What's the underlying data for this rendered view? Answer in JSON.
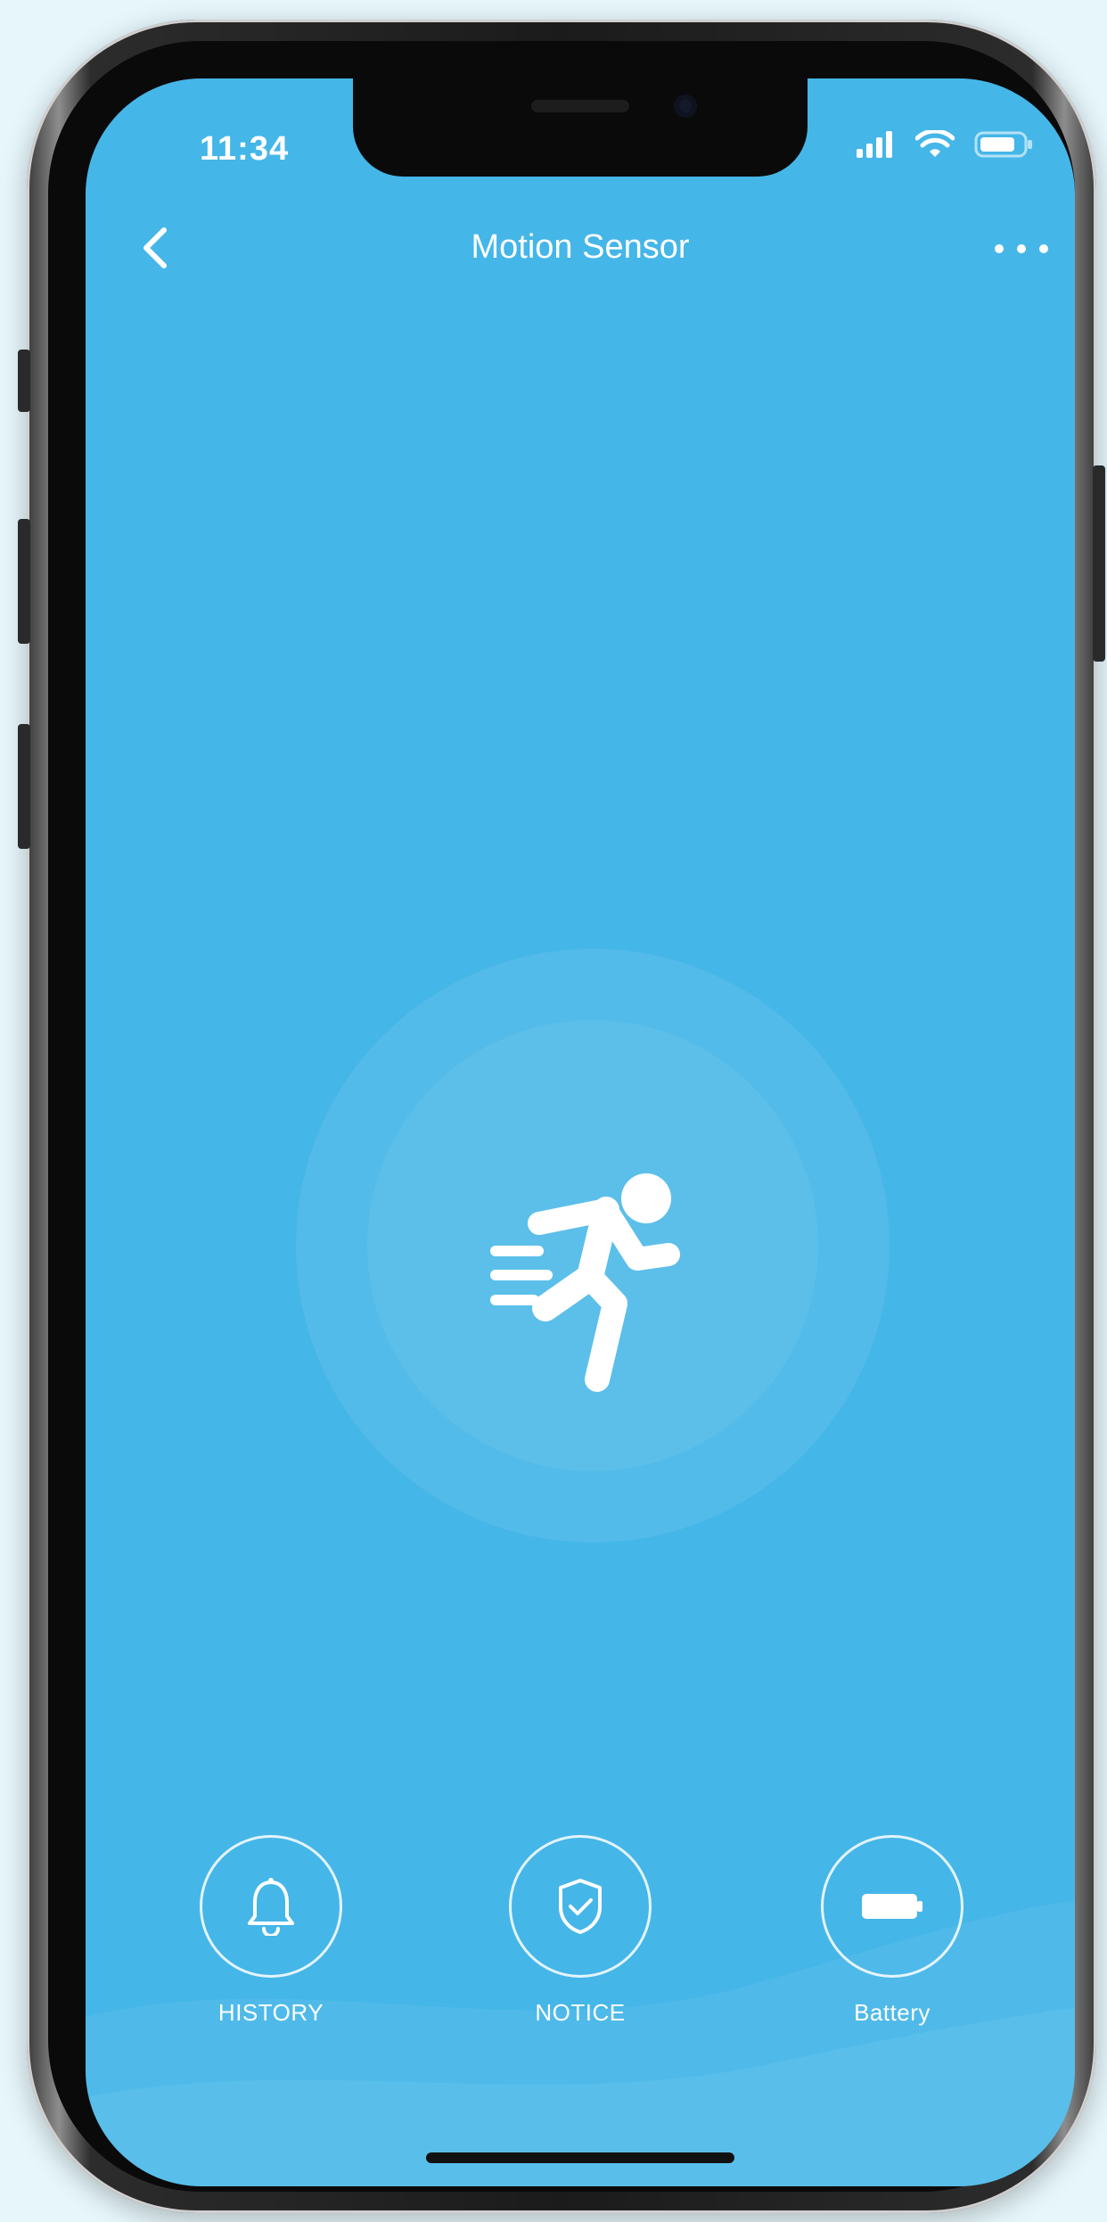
{
  "status_bar": {
    "time": "11:34",
    "icons": [
      "signal-icon",
      "wifi-icon",
      "battery-icon"
    ]
  },
  "nav": {
    "back_icon": "chevron-left-icon",
    "title": "Motion Sensor",
    "more_icon": "more-dots-icon"
  },
  "center": {
    "icon": "running-person-icon"
  },
  "actions": [
    {
      "label": "HISTORY",
      "icon": "bell-icon"
    },
    {
      "label": "NOTICE",
      "icon": "shield-check-icon"
    },
    {
      "label": "Battery",
      "icon": "battery-icon"
    }
  ],
  "colors": {
    "screen_bg": "#45b6e8",
    "foreground": "#ffffff",
    "page_bg": "#e6f6fb"
  }
}
